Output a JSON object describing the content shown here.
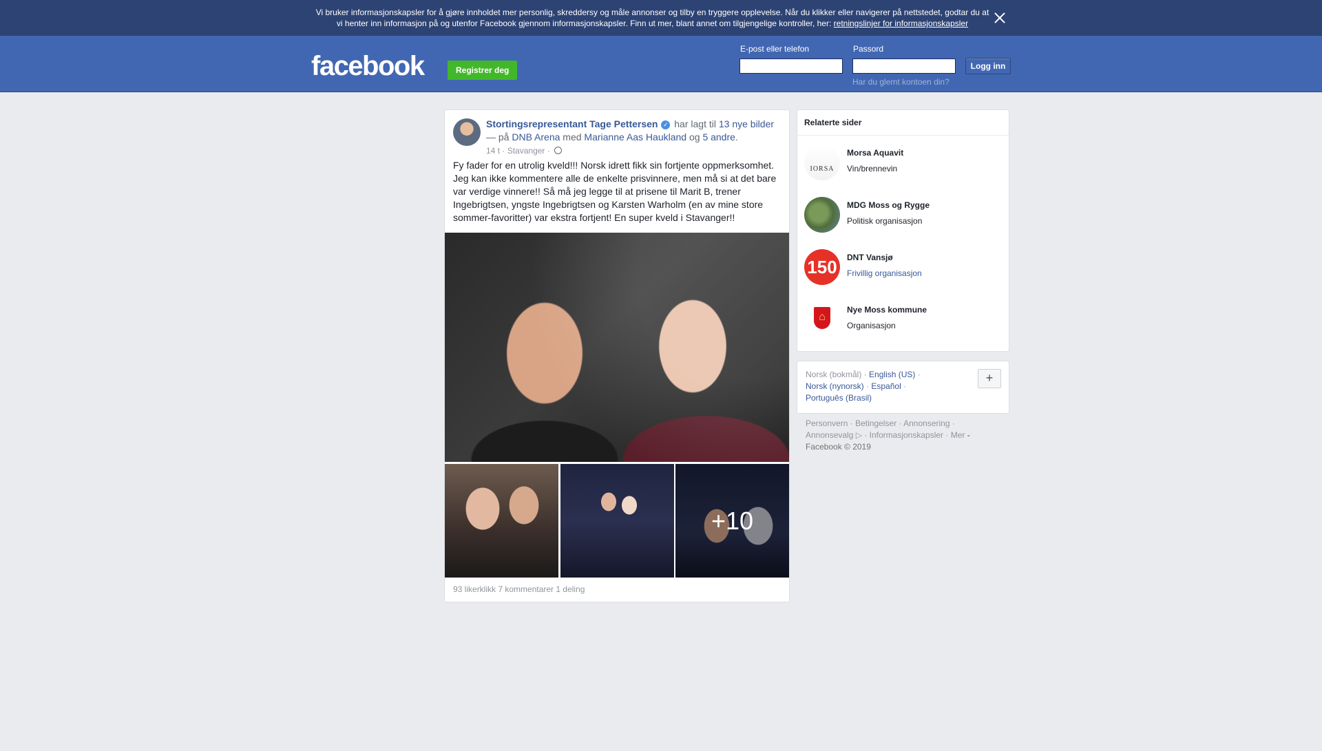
{
  "cookie_banner": {
    "text": "Vi bruker informasjonskapsler for å gjøre innholdet mer personlig, skreddersy og måle annonser og tilby en tryggere opplevelse. Når du klikker eller navigerer på nettstedet, godtar du at vi henter inn informasjon på og utenfor Facebook gjennom informasjonskapsler. Finn ut mer, blant annet om tilgjengelige kontroller, her:",
    "link": "retningslinjer for informasjonskapsler",
    "close_icon": "close-icon"
  },
  "header": {
    "logo": "facebook",
    "register": "Registrer deg",
    "email_label": "E-post eller telefon",
    "email_value": "",
    "password_label": "Passord",
    "password_value": "",
    "login": "Logg inn",
    "forgot": "Har du glemt kontoen din?",
    "colors": {
      "bar": "#4267b2",
      "register": "#42b72a"
    }
  },
  "post": {
    "author": "Stortingsrepresentant Tage Pettersen",
    "verified_icon": "verified-badge-icon",
    "action_pre": "har lagt til",
    "photos_link": "13 nye bilder",
    "dash_on": "— på",
    "place": "DNB Arena",
    "with": "med",
    "tagged": "Marianne Aas Haukland",
    "and": "og",
    "others": "5 andre",
    "period": ".",
    "time": "14 t",
    "location": "Stavanger",
    "sep": "·",
    "privacy_icon": "globe-icon",
    "text": "Fy fader for en utrolig kveld!!! Norsk idrett fikk sin fortjente oppmerksomhet. Jeg kan ikke kommentere alle de enkelte prisvinnere, men må si at det bare var verdige vinnere!! Så må jeg legge til at prisene til Marit B, trener Ingebrigtsen, yngste Ingebrigtsen og Karsten Warholm (en av mine store sommer-favoritter) var ekstra fortjent! En super kveld i Stavanger!!",
    "more_photos": "+10",
    "likes": "93 likerklikk",
    "comments": "7 kommentarer",
    "shares": "1 deling"
  },
  "related": {
    "title": "Relaterte sider",
    "items": [
      {
        "name": "Morsa Aquavit",
        "category": "Vin/brennevin",
        "logo_text": "IORSA"
      },
      {
        "name": "MDG Moss og Rygge",
        "category": "Politisk organisasjon"
      },
      {
        "name": "DNT Vansjø",
        "category": "Frivillig organisasjon",
        "logo_text": "150"
      },
      {
        "name": "Nye Moss kommune",
        "category": "Organisasjon"
      }
    ]
  },
  "languages": {
    "current": "Norsk (bokmål)",
    "options": [
      "English (US)",
      "Norsk (nynorsk)",
      "Español",
      "Português (Brasil)"
    ],
    "sep": "·",
    "add": "+"
  },
  "footer": {
    "links": [
      "Personvern",
      "Betingelser",
      "Annonsering",
      "Annonsevalg",
      "Informasjonskapsler",
      "Mer"
    ],
    "adchoices_icon": "adchoices-icon",
    "sep": "·",
    "copyright": "Facebook © 2019"
  }
}
